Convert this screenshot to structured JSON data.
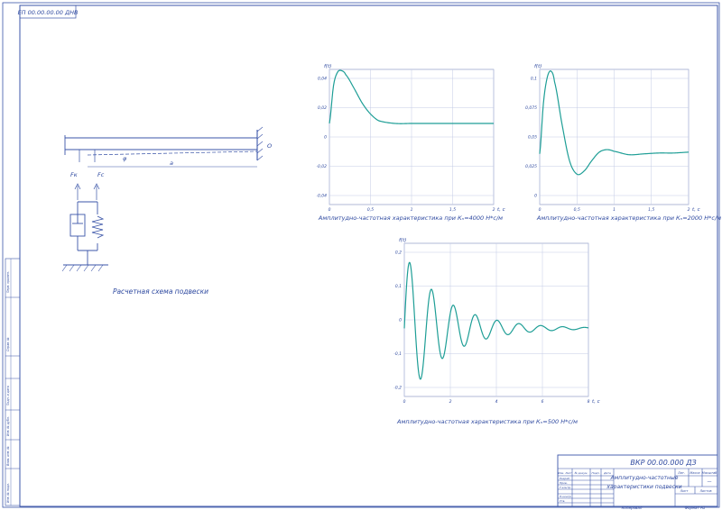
{
  "sheet": {
    "code_rotated": "ЕП 00.00.00.00 ДНВ",
    "title_block": {
      "doc_code": "ВКР 00.00.000 ДЗ",
      "sheet_name_line1": "Амплитудно-частотные",
      "sheet_name_line2": "характеристики подвески",
      "col_lit": "Лит.",
      "col_mass": "Масса",
      "col_scale": "Масштаб",
      "sheet_label": "Лист",
      "sheets_label": "Листов",
      "scale_value": "—",
      "left_rows": [
        "Изм. Лист",
        "№ докум.",
        "Подп.",
        "Дата"
      ],
      "roles": [
        "Разраб.",
        "Пров.",
        "Т.контр.",
        "",
        "Н.контр.",
        "Утв."
      ],
      "copied": "Копировал",
      "format": "Формат А1"
    },
    "side_stamp": [
      "Перв. примен.",
      "Справ. №",
      "Подп. и дата",
      "Инв. № дубл.",
      "Взам. инв. №",
      "Подп. и дата",
      "Инв. № подл."
    ]
  },
  "scheme": {
    "caption": "Расчетная схема подвески",
    "labels": {
      "fk": "Fк",
      "fc": "Fс",
      "phi": "φ",
      "a": "a",
      "o": "O"
    }
  },
  "chart_data": [
    {
      "type": "line",
      "title": "Амплитудно-частотная характеристика при Кₙ=4000 Н*с/м",
      "ylabel": "f(t)",
      "xlabel": "t, c",
      "xlim": [
        0,
        2
      ],
      "ylim": [
        -0.06,
        0.04
      ],
      "xticks": [
        "0",
        "0,5",
        "1",
        "1,5",
        "2"
      ],
      "yticks": [
        "0,04",
        "0,02",
        "0",
        "-0,02",
        "-0,04"
      ],
      "grid": true,
      "x": [
        0,
        0.05,
        0.1,
        0.15,
        0.2,
        0.3,
        0.4,
        0.5,
        0.6,
        0.8,
        1.0,
        1.5,
        2.0
      ],
      "y": [
        0,
        0.028,
        0.038,
        0.039,
        0.036,
        0.026,
        0.015,
        0.007,
        0.002,
        0.0,
        0.0,
        0.0,
        0.0
      ]
    },
    {
      "type": "line",
      "title": "Амплитудно-частотная характеристика при Кₙ=2000 Н*с/м",
      "ylabel": "f(t)",
      "xlabel": "t, c",
      "xlim": [
        0,
        2
      ],
      "ylim": [
        -0.06,
        0.1
      ],
      "xticks": [
        "0",
        "0,5",
        "1",
        "1,5",
        "2"
      ],
      "yticks": [
        "0,1",
        "0,075",
        "0,05",
        "0,025",
        "0"
      ],
      "grid": true,
      "x": [
        0,
        0.05,
        0.1,
        0.15,
        0.2,
        0.3,
        0.4,
        0.5,
        0.6,
        0.7,
        0.8,
        0.9,
        1.0,
        1.2,
        1.4,
        1.6,
        1.8,
        2.0
      ],
      "y": [
        0,
        0.06,
        0.09,
        0.098,
        0.085,
        0.035,
        -0.008,
        -0.024,
        -0.02,
        -0.008,
        0.002,
        0.005,
        0.003,
        -0.001,
        0.0,
        0.001,
        0.001,
        0.002
      ]
    },
    {
      "type": "line",
      "title": "Амплитудно-частотная характеристика при Кₙ=500 Н*с/м",
      "ylabel": "f(t)",
      "xlabel": "t, c",
      "xlim": [
        0,
        8
      ],
      "ylim": [
        -0.2,
        0.25
      ],
      "xticks": [
        "0",
        "2",
        "4",
        "6",
        "8"
      ],
      "yticks": [
        "0,2",
        "0,1",
        "0",
        "-0,1",
        "-0,2"
      ],
      "grid": true,
      "damping": 0.55,
      "period": 0.95,
      "amplitude": 0.22
    }
  ]
}
